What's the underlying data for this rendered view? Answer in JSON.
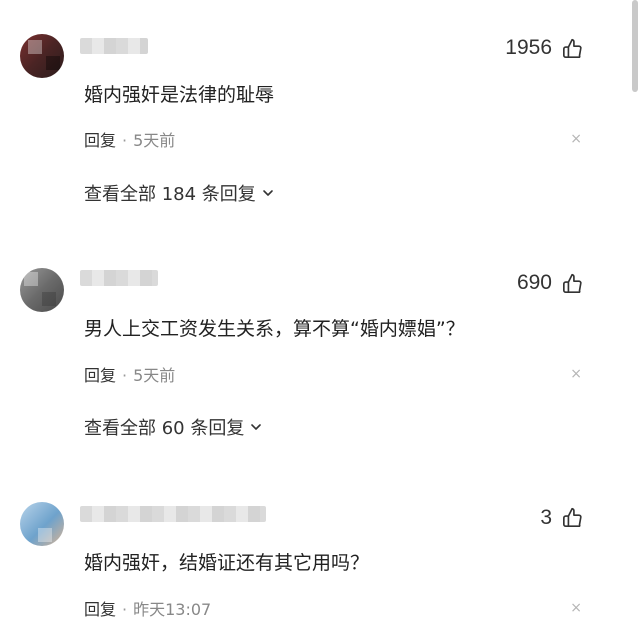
{
  "comments": [
    {
      "likes": "1956",
      "text": "婚内强奸是法律的耻辱",
      "reply_label": "回复",
      "separator": "·",
      "time": "5天前",
      "close": "×",
      "view_all": "查看全部 184 条回复"
    },
    {
      "likes": "690",
      "text": "男人上交工资发生关系，算不算“婚内嫖娼”？",
      "reply_label": "回复",
      "separator": "·",
      "time": "5天前",
      "close": "×",
      "view_all": "查看全部 60 条回复"
    },
    {
      "likes": "3",
      "text": "婚内强奸，结婚证还有其它用吗？",
      "reply_label": "回复",
      "separator": "·",
      "time": "昨天13:07",
      "close": "×"
    }
  ],
  "icons": {
    "like": "thumbs-up-icon",
    "expand": "chevron-down-icon",
    "dismiss": "close-icon"
  }
}
